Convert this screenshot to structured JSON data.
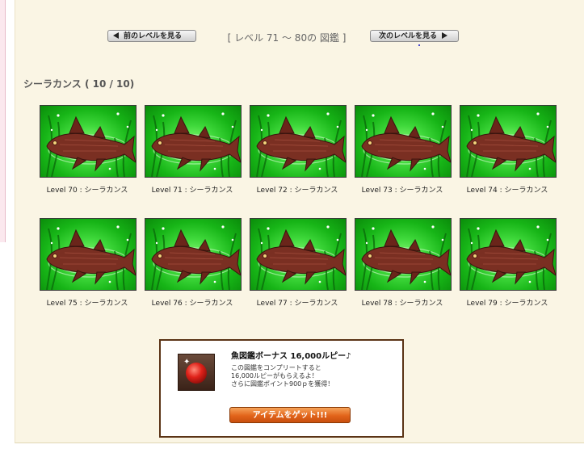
{
  "nav": {
    "prev_label": "前のレベルを見る",
    "next_label": "次のレベルを見る",
    "range_title": "[ レベル 71 ～ 80の 図鑑 ]"
  },
  "section": {
    "title": "シーラカンス ( 10 / 10)"
  },
  "cards": [
    {
      "caption": "Level 70 : シーラカンス"
    },
    {
      "caption": "Level 71 : シーラカンス"
    },
    {
      "caption": "Level 72 : シーラカンス"
    },
    {
      "caption": "Level 73 : シーラカンス"
    },
    {
      "caption": "Level 74 : シーラカンス"
    },
    {
      "caption": "Level 75 : シーラカンス"
    },
    {
      "caption": "Level 76 : シーラカンス"
    },
    {
      "caption": "Level 77 : シーラカンス"
    },
    {
      "caption": "Level 78 : シーラカンス"
    },
    {
      "caption": "Level 79 : シーラカンス"
    }
  ],
  "bonus": {
    "title": "魚図鑑ボーナス 16,000ルピー♪",
    "desc_lines": [
      "この図鑑をコンプリートすると",
      "16,000ルピーがもらえるよ！",
      "さらに図鑑ポイント900ｐを獲得！"
    ],
    "button_label": "アイテムをゲット!!!",
    "icon": "ruby-gem-icon"
  },
  "colors": {
    "panel_bg": "#faf5e4",
    "bonus_border": "#5a3315",
    "button_orange": "#e2641a"
  }
}
